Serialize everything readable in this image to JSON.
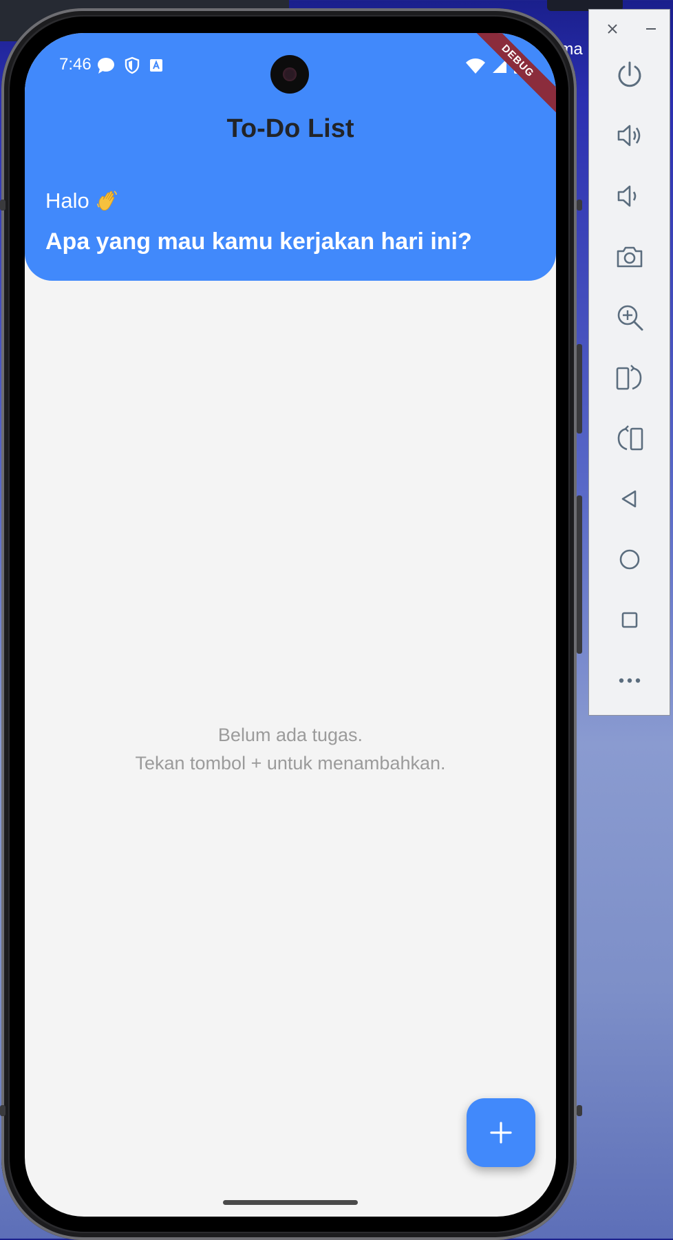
{
  "status_bar": {
    "time": "7:46"
  },
  "debug_banner": "DEBUG",
  "app": {
    "title": "To-Do List",
    "greeting": "Halo",
    "subtitle": "Apa yang mau kamu kerjakan hari ini?",
    "empty_line1": "Belum ada tugas.",
    "empty_line2": "Tekan tombol + untuk menambahkan.",
    "fab_label": "+"
  },
  "desktop": {
    "partial_text": "ama",
    "partial_text2": "..."
  },
  "emulator_controls": [
    "power-icon",
    "volume-up-icon",
    "volume-down-icon",
    "camera-icon",
    "zoom-icon",
    "rotate-left-icon",
    "rotate-right-icon",
    "back-icon",
    "home-icon",
    "overview-icon",
    "more-icon"
  ],
  "colors": {
    "header": "#4189fb",
    "fab": "#4189fb",
    "title_text": "#222428",
    "empty_text": "#9b9b9b",
    "debug_banner": "#8b2c3c"
  }
}
